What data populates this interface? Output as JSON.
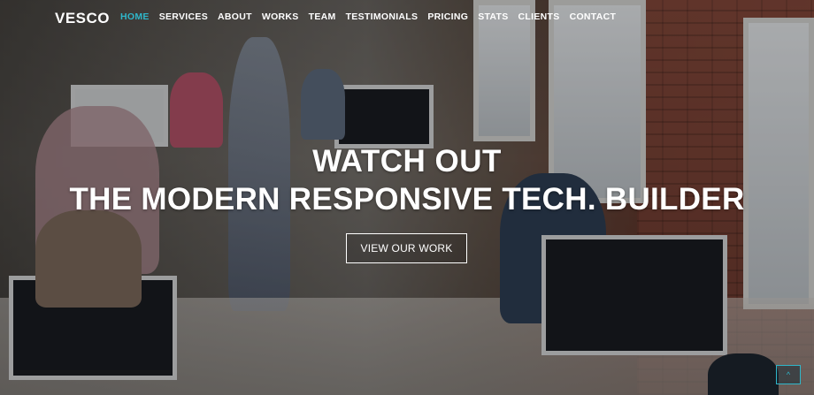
{
  "brand": {
    "logo": "VESCO"
  },
  "nav": {
    "items": [
      {
        "label": "HOME",
        "active": true
      },
      {
        "label": "SERVICES",
        "active": false
      },
      {
        "label": "ABOUT",
        "active": false
      },
      {
        "label": "WORKS",
        "active": false
      },
      {
        "label": "TEAM",
        "active": false
      },
      {
        "label": "TESTIMONIALS",
        "active": false
      },
      {
        "label": "PRICING",
        "active": false
      },
      {
        "label": "STATS",
        "active": false
      },
      {
        "label": "CLIENTS",
        "active": false
      },
      {
        "label": "CONTACT",
        "active": false
      }
    ]
  },
  "hero": {
    "line1": "WATCH OUT",
    "line2": "THE MODERN RESPONSIVE TECH. BUILDER",
    "cta_label": "VIEW OUR WORK"
  },
  "scroll_top": {
    "glyph": "^"
  },
  "colors": {
    "accent": "#2fb6c9",
    "text": "#ffffff"
  }
}
